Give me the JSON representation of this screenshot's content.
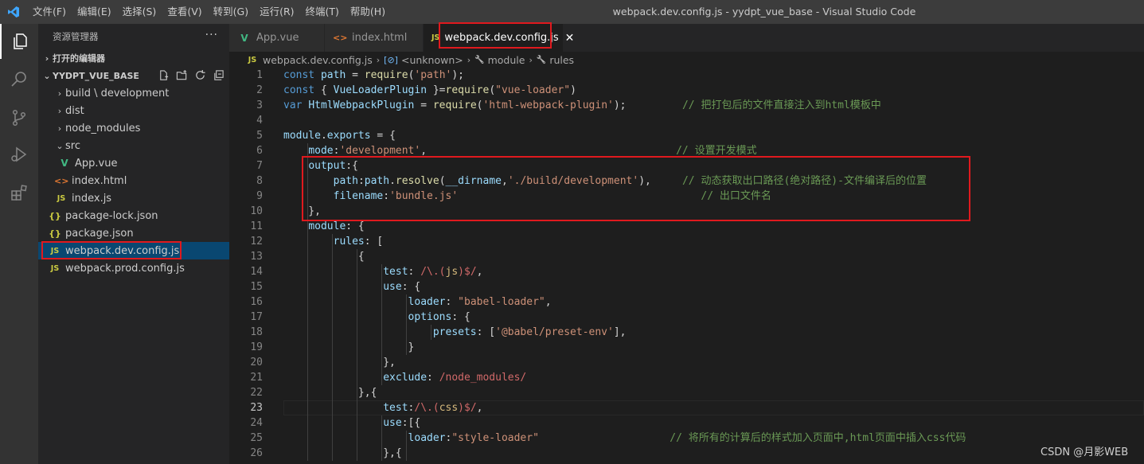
{
  "titlebar": {
    "menus": [
      "文件(F)",
      "编辑(E)",
      "选择(S)",
      "查看(V)",
      "转到(G)",
      "运行(R)",
      "终端(T)",
      "帮助(H)"
    ],
    "window_title": "webpack.dev.config.js - yydpt_vue_base - Visual Studio Code"
  },
  "sidebar": {
    "header": "资源管理器",
    "more": "···",
    "open_editors": "打开的编辑器",
    "folder_name": "YYDPT_VUE_BASE",
    "items": [
      {
        "label": "build \\ development",
        "kind": "folder",
        "icon": "chevron-right-icon",
        "depth": 1
      },
      {
        "label": "dist",
        "kind": "folder",
        "icon": "chevron-right-icon",
        "depth": 1
      },
      {
        "label": "node_modules",
        "kind": "folder",
        "icon": "chevron-right-icon",
        "depth": 1
      },
      {
        "label": "src",
        "kind": "folder-open",
        "icon": "chevron-down-icon",
        "depth": 1
      },
      {
        "label": "App.vue",
        "kind": "vue",
        "icon": "vue-file-icon",
        "depth": 2
      },
      {
        "label": "index.html",
        "kind": "html",
        "icon": "html-file-icon",
        "depth": 2
      },
      {
        "label": "index.js",
        "kind": "js",
        "icon": "js-file-icon",
        "depth": 2
      },
      {
        "label": "package-lock.json",
        "kind": "json",
        "icon": "json-file-icon",
        "depth": 1
      },
      {
        "label": "package.json",
        "kind": "json",
        "icon": "json-file-icon",
        "depth": 1
      },
      {
        "label": "webpack.dev.config.js",
        "kind": "js",
        "icon": "js-file-icon",
        "depth": 1,
        "selected": true
      },
      {
        "label": "webpack.prod.config.js",
        "kind": "js",
        "icon": "js-file-icon",
        "depth": 1
      }
    ]
  },
  "tabs": [
    {
      "label": "App.vue",
      "icon": "vue-file-icon",
      "glyph": "V"
    },
    {
      "label": "index.html",
      "icon": "html-file-icon",
      "glyph": "<>"
    },
    {
      "label": "webpack.dev.config.js",
      "icon": "js-file-icon",
      "glyph": "JS",
      "active": true,
      "close": "✕"
    }
  ],
  "breadcrumb": [
    "webpack.dev.config.js",
    "<unknown>",
    "module",
    "rules"
  ],
  "breadcrumb_icons": [
    "JS",
    "[⊘]",
    "🔧",
    "🔧"
  ],
  "editor": {
    "current_line": 23,
    "lines": [
      {
        "n": "1",
        "t": [
          [
            "kw",
            "const "
          ],
          [
            "var",
            "path"
          ],
          [
            "",
            "  = "
          ],
          [
            "fn",
            "require"
          ],
          [
            "",
            "("
          ],
          [
            "str",
            "'path'"
          ],
          [
            "",
            ");"
          ]
        ]
      },
      {
        "n": "2",
        "t": [
          [
            "kw",
            "const "
          ],
          [
            "",
            "{ "
          ],
          [
            "var",
            "VueLoaderPlugin"
          ],
          [
            "",
            ""
          ],
          [
            "",
            "  }="
          ],
          [
            "fn",
            "require"
          ],
          [
            "",
            "("
          ],
          [
            "str",
            "\"vue-loader\""
          ],
          [
            "",
            ")"
          ]
        ]
      },
      {
        "n": "3",
        "t": [
          [
            "kw",
            "var "
          ],
          [
            "var",
            "HtmlWebpackPlugin"
          ],
          [
            "",
            "  = "
          ],
          [
            "fn",
            "require"
          ],
          [
            "",
            "("
          ],
          [
            "str",
            "'html-webpack-plugin'"
          ],
          [
            "",
            ");"
          ],
          [
            "",
            "         "
          ],
          [
            "cmt",
            "// 把打包后的文件直接注入到html模板中"
          ]
        ]
      },
      {
        "n": "4",
        "t": []
      },
      {
        "n": "5",
        "t": [
          [
            "var",
            "module"
          ],
          [
            "",
            "."
          ],
          [
            "var",
            "exports"
          ],
          [
            "",
            "  = {"
          ]
        ]
      },
      {
        "n": "6",
        "t": [
          [
            "",
            "    "
          ],
          [
            "var",
            "mode"
          ],
          [
            "",
            ":"
          ],
          [
            "str",
            "'development'"
          ],
          [
            "",
            ","
          ],
          [
            "",
            "                                        "
          ],
          [
            "cmt",
            "// 设置开发模式"
          ]
        ]
      },
      {
        "n": "7",
        "t": [
          [
            "",
            "    "
          ],
          [
            "var",
            "output"
          ],
          [
            "",
            ":{"
          ]
        ]
      },
      {
        "n": "8",
        "t": [
          [
            "",
            "        "
          ],
          [
            "var",
            "path"
          ],
          [
            "",
            ":"
          ],
          [
            "var",
            "path"
          ],
          [
            "",
            "."
          ],
          [
            "fn",
            "resolve"
          ],
          [
            "",
            "("
          ],
          [
            "var",
            "__dirname"
          ],
          [
            "",
            ","
          ],
          [
            "str",
            "'./build/development'"
          ],
          [
            "",
            "),"
          ],
          [
            "",
            "     "
          ],
          [
            "cmt",
            "// 动态获取出口路径(绝对路径)-文件编译后的位置"
          ]
        ]
      },
      {
        "n": "9",
        "t": [
          [
            "",
            "        "
          ],
          [
            "var",
            "filename"
          ],
          [
            "",
            ":"
          ],
          [
            "str",
            "'bundle.js'"
          ],
          [
            "",
            "                                       "
          ],
          [
            "cmt",
            "// 出口文件名"
          ]
        ]
      },
      {
        "n": "10",
        "t": [
          [
            "",
            "    },"
          ]
        ]
      },
      {
        "n": "11",
        "t": [
          [
            "",
            "    "
          ],
          [
            "var",
            "module"
          ],
          [
            "",
            ": {"
          ]
        ]
      },
      {
        "n": "12",
        "t": [
          [
            "",
            "        "
          ],
          [
            "var",
            "rules"
          ],
          [
            "",
            ": ["
          ]
        ]
      },
      {
        "n": "13",
        "t": [
          [
            "",
            "            {"
          ]
        ]
      },
      {
        "n": "14",
        "t": [
          [
            "",
            "                "
          ],
          [
            "var",
            "test"
          ],
          [
            "",
            ": "
          ],
          [
            "re",
            "/\\.("
          ],
          [
            "rec",
            "js"
          ],
          [
            "re",
            ")$/"
          ],
          [
            "",
            ","
          ]
        ]
      },
      {
        "n": "15",
        "t": [
          [
            "",
            "                "
          ],
          [
            "var",
            "use"
          ],
          [
            "",
            ": {"
          ]
        ]
      },
      {
        "n": "16",
        "t": [
          [
            "",
            "                    "
          ],
          [
            "var",
            "loader"
          ],
          [
            "",
            ": "
          ],
          [
            "str",
            "\"babel-loader\""
          ],
          [
            "",
            ","
          ]
        ]
      },
      {
        "n": "17",
        "t": [
          [
            "",
            "                    "
          ],
          [
            "var",
            "options"
          ],
          [
            "",
            ": {"
          ]
        ]
      },
      {
        "n": "18",
        "t": [
          [
            "",
            "                        "
          ],
          [
            "var",
            "presets"
          ],
          [
            "",
            ": ["
          ],
          [
            "str",
            "'@babel/preset-env'"
          ],
          [
            "",
            "],"
          ]
        ]
      },
      {
        "n": "19",
        "t": [
          [
            "",
            "                    }"
          ]
        ]
      },
      {
        "n": "20",
        "t": [
          [
            "",
            "                },"
          ]
        ]
      },
      {
        "n": "21",
        "t": [
          [
            "",
            "                "
          ],
          [
            "var",
            "exclude"
          ],
          [
            "",
            ": "
          ],
          [
            "re",
            "/node_modules/"
          ]
        ]
      },
      {
        "n": "22",
        "t": [
          [
            "",
            "            },{"
          ]
        ]
      },
      {
        "n": "23",
        "t": [
          [
            "",
            "                "
          ],
          [
            "var",
            "test"
          ],
          [
            "",
            ":"
          ],
          [
            "re",
            "/\\.("
          ],
          [
            "rec",
            "css"
          ],
          [
            "re",
            ")$/"
          ],
          [
            "",
            ","
          ]
        ]
      },
      {
        "n": "24",
        "t": [
          [
            "",
            "                "
          ],
          [
            "var",
            "use"
          ],
          [
            "",
            ":[{"
          ]
        ]
      },
      {
        "n": "25",
        "t": [
          [
            "",
            "                    "
          ],
          [
            "var",
            "loader"
          ],
          [
            "",
            ":"
          ],
          [
            "str",
            "\"style-loader\""
          ],
          [
            "",
            "                     "
          ],
          [
            "cmt",
            "// 将所有的计算后的样式加入页面中,html页面中插入css代码"
          ]
        ]
      },
      {
        "n": "26",
        "t": [
          [
            "",
            "                },{"
          ]
        ]
      }
    ]
  },
  "watermark": "CSDN @月影WEB",
  "colors": {
    "annotation": "#e0191e",
    "selection": "#094771",
    "accent": "#007acc"
  }
}
